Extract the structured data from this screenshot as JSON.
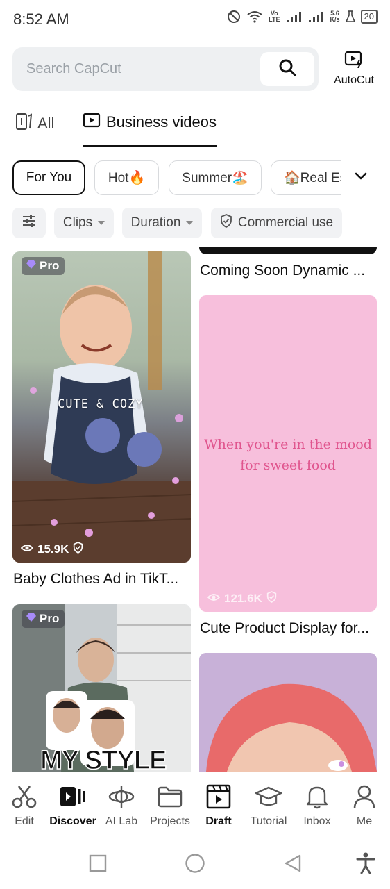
{
  "status_bar": {
    "time": "8:52 AM",
    "network_speed_top": "5.6",
    "network_speed_bottom": "K/s",
    "volte_top": "Vo",
    "volte_bottom": "LTE",
    "battery": "20",
    "icons": [
      "dnd-icon",
      "wifi-icon",
      "signal-icon",
      "signal-icon",
      "flask-icon",
      "battery-icon"
    ]
  },
  "search": {
    "placeholder": "Search CapCut",
    "icon": "search-icon"
  },
  "autocut": {
    "label": "AutoCut",
    "icon": "autocut-icon"
  },
  "tabs": [
    {
      "label": "All",
      "icon": "all-icon",
      "active": false
    },
    {
      "label": "Business videos",
      "icon": "play-box-icon",
      "active": true
    }
  ],
  "chips": [
    {
      "label": "For You",
      "active": true
    },
    {
      "label": "Hot🔥",
      "active": false
    },
    {
      "label": "Summer🏖️",
      "active": false
    },
    {
      "label": "🏠Real Es",
      "active": false
    }
  ],
  "filters": {
    "settings_icon": "sliders-icon",
    "clips": "Clips",
    "duration": "Duration",
    "commercial": "Commercial use"
  },
  "cards": {
    "left1": {
      "badge": "Pro",
      "overlay_text": "CUTE & COZY",
      "views": "15.9K",
      "title": "Baby Clothes Ad in TikT..."
    },
    "left2": {
      "badge": "Pro",
      "overlay_text": "MY STYLE"
    },
    "right0": {
      "title": "Coming Soon Dynamic ..."
    },
    "right1": {
      "overlay_line1": "When you're in the mood",
      "overlay_line2": "for sweet food",
      "views": "121.6K",
      "title": "Cute Product Display for..."
    }
  },
  "nav": [
    {
      "label": "Edit",
      "icon": "scissors-icon",
      "active": false
    },
    {
      "label": "Discover",
      "icon": "discover-icon",
      "active": true
    },
    {
      "label": "AI Lab",
      "icon": "ai-lab-icon",
      "active": false
    },
    {
      "label": "Projects",
      "icon": "folder-icon",
      "active": false
    },
    {
      "label": "Draft",
      "icon": "clapper-icon",
      "active": false
    },
    {
      "label": "Tutorial",
      "icon": "graduation-cap-icon",
      "active": false
    },
    {
      "label": "Inbox",
      "icon": "bell-icon",
      "active": false
    },
    {
      "label": "Me",
      "icon": "person-icon",
      "active": false
    }
  ],
  "system_nav": [
    "recent-apps-icon",
    "home-icon",
    "back-icon",
    "accessibility-icon"
  ]
}
